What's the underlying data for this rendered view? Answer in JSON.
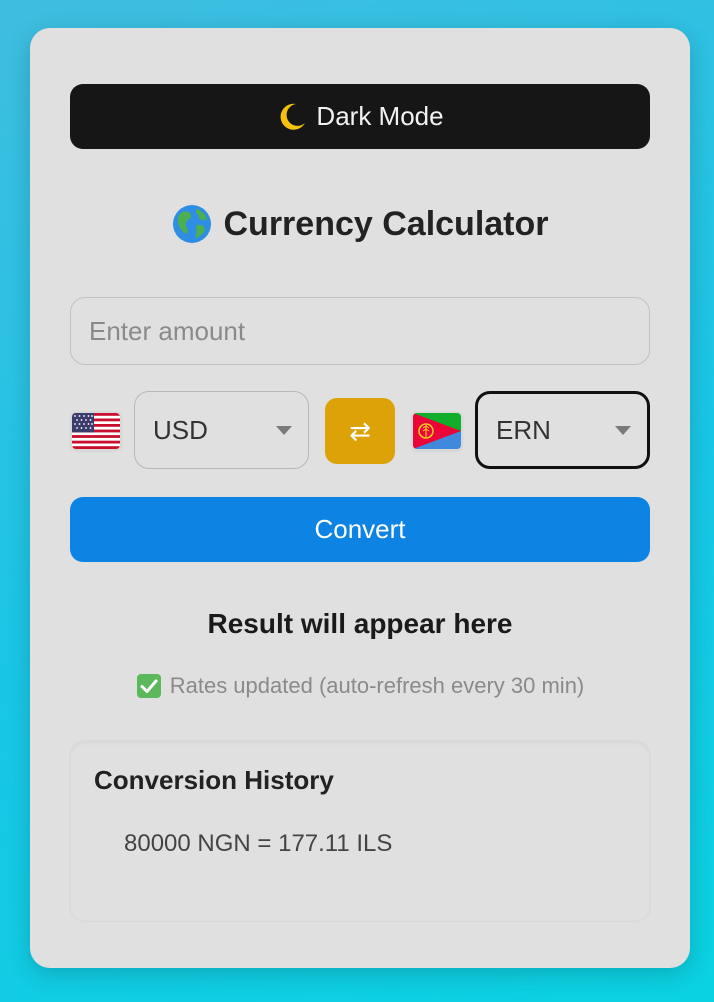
{
  "toggle": {
    "label": "Dark Mode",
    "icon": "moon-icon"
  },
  "header": {
    "title": "Currency Calculator",
    "icon": "globe-icon"
  },
  "amount": {
    "placeholder": "Enter amount",
    "value": ""
  },
  "from_currency": {
    "selected": "USD",
    "flag": "us-flag-icon"
  },
  "to_currency": {
    "selected": "ERN",
    "flag": "eritrea-flag-icon"
  },
  "swap": {
    "glyph": "⇄"
  },
  "convert": {
    "label": "Convert"
  },
  "result": {
    "text": "Result will appear here"
  },
  "status": {
    "text": "Rates updated (auto-refresh every 30 min)",
    "icon": "check-icon"
  },
  "history": {
    "title": "Conversion History",
    "entries": [
      "80000 NGN = 177.11 ILS"
    ]
  },
  "colors": {
    "card_bg": "#e0e0e0",
    "dark_button": "#161616",
    "swap_button": "#dca208",
    "convert_button": "#0d84e3",
    "page_gradient": [
      "#3fbde0",
      "#0ad2e2"
    ]
  }
}
